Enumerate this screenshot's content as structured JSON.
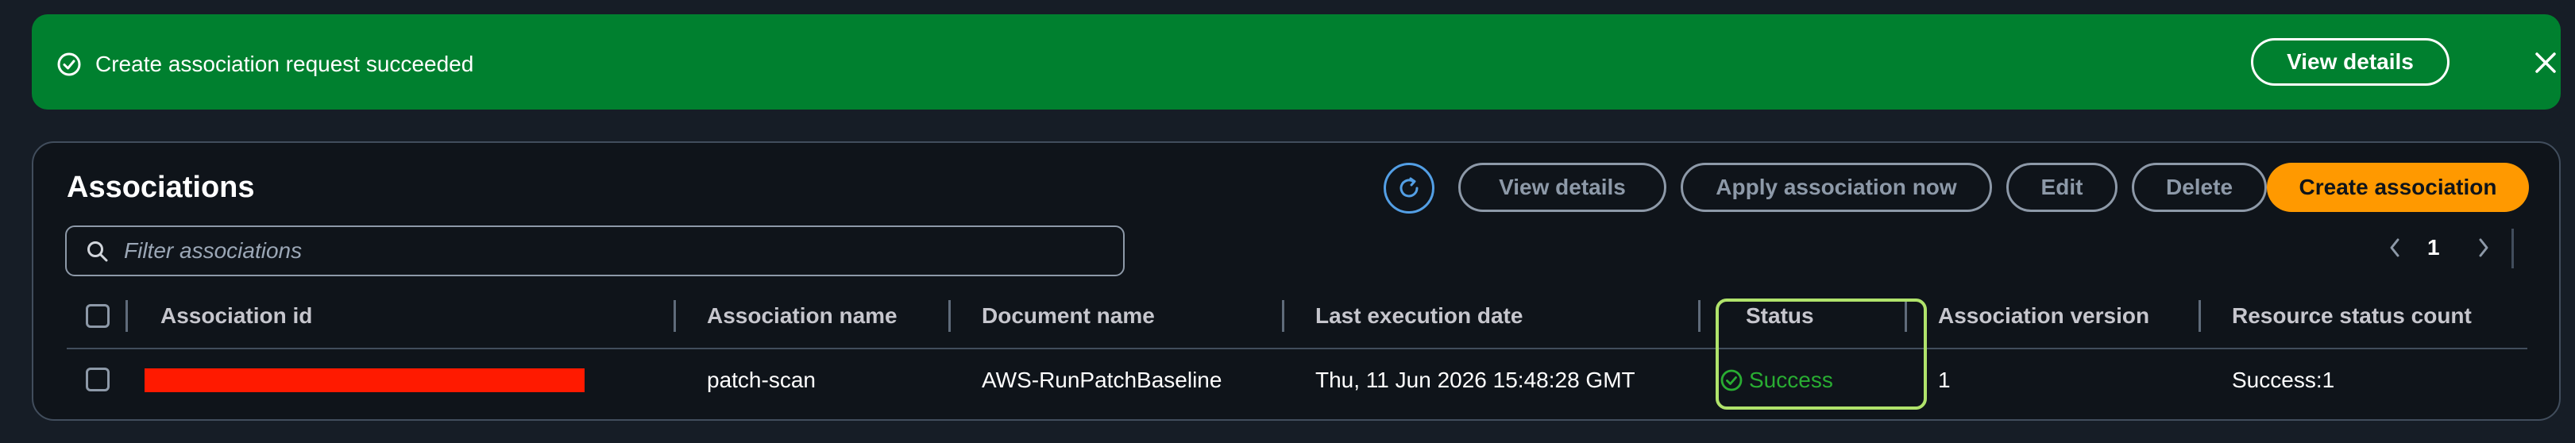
{
  "flash": {
    "message": "Create association request succeeded",
    "view_details_label": "View details",
    "color": "#00802f"
  },
  "panel": {
    "title": "Associations",
    "actions": {
      "refresh_icon": "refresh-icon",
      "view_details": "View details",
      "apply_now": "Apply association now",
      "edit": "Edit",
      "delete": "Delete",
      "create": "Create association"
    },
    "filter": {
      "placeholder": "Filter associations",
      "value": ""
    },
    "pagination": {
      "current_page": "1"
    }
  },
  "table": {
    "columns": [
      "Association id",
      "Association name",
      "Document name",
      "Last execution date",
      "Status",
      "Association version",
      "Resource status count"
    ],
    "rows": [
      {
        "association_id": "",
        "association_name": "patch-scan",
        "document_name": "AWS-RunPatchBaseline",
        "last_execution_date": "Thu, 11 Jun 2026 15:48:28 GMT",
        "status": "Success",
        "association_version": "1",
        "resource_status_count": "Success:1"
      }
    ]
  },
  "colors": {
    "accent": "#ff9900",
    "success": "#29ad32",
    "link": "#539fe5",
    "highlight": "#b0e36b",
    "redaction": "#ff1a00"
  }
}
